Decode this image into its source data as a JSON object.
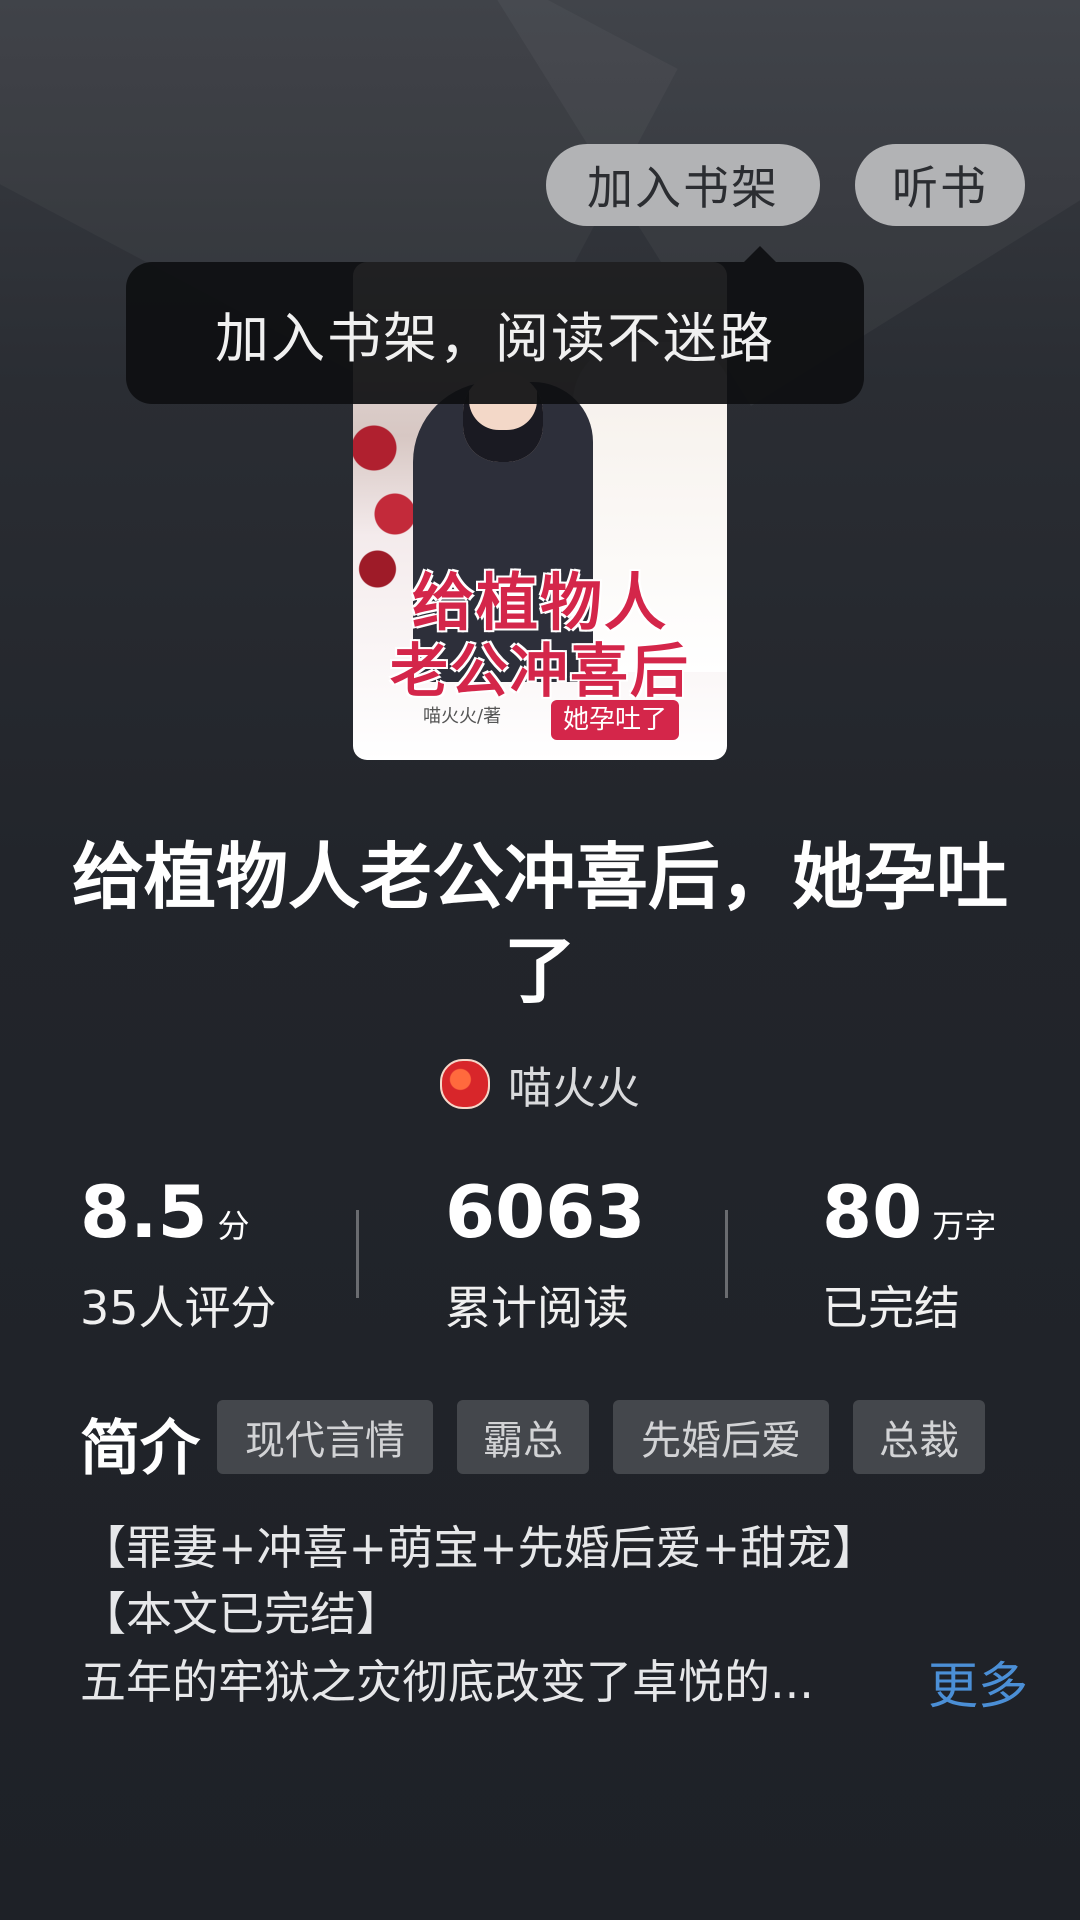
{
  "header": {
    "add_shelf_label": "加入书架",
    "listen_label": "听书"
  },
  "tooltip": {
    "text": "加入书架，阅读不迷路"
  },
  "cover": {
    "title_line1": "给植物人",
    "title_line2": "老公冲喜后",
    "author_label": "喵火火/著",
    "badge": "她孕吐了"
  },
  "book": {
    "title": "给植物人老公冲喜后，她孕吐了",
    "author": "喵火火"
  },
  "stats": {
    "score": {
      "value": "8.5",
      "unit": "分",
      "label": "35人评分"
    },
    "reads": {
      "value": "6063",
      "label": "累计阅读"
    },
    "words": {
      "value": "80",
      "unit": "万字",
      "label": "已完结"
    }
  },
  "intro": {
    "heading": "简介",
    "tags": [
      "现代言情",
      "霸总",
      "先婚后爱",
      "总裁"
    ],
    "line1": "【罪妻+冲喜+萌宝+先婚后爱+甜宠】",
    "line2": "【本文已完结】",
    "line3": "五年的牢狱之灾彻底改变了卓悦的...",
    "more_label": "更多"
  },
  "colors": {
    "accent_link": "#4b8fd6",
    "background": "#1f2228",
    "pill": "#b2b3b5"
  }
}
